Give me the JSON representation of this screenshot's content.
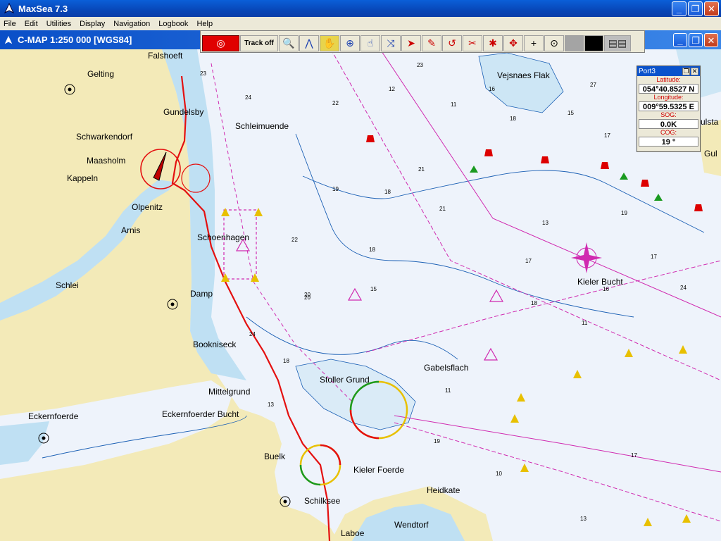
{
  "app": {
    "title": "MaxSea 7.3"
  },
  "menu": [
    "File",
    "Edit",
    "Utilities",
    "Display",
    "Navigation",
    "Logbook",
    "Help"
  ],
  "chart_window": {
    "title": "C-MAP  1:250 000 [WGS84]"
  },
  "toolbar": {
    "track_label": "Track off"
  },
  "port_window": {
    "title": "Port3",
    "latitude_label": "Latitude:",
    "latitude": "054°40.8527 N",
    "longitude_label": "Longitude:",
    "longitude": "009°59.5325 E",
    "sog_label": "SOG:",
    "sog": "0.0K",
    "cog_label": "COG:",
    "cog": "19 °"
  },
  "places": {
    "falshoeft": "Falshoeft",
    "gelting": "Gelting",
    "gundelsby": "Gundelsby",
    "schwarkendorf": "Schwarkendorf",
    "maasholm": "Maasholm",
    "kappeln": "Kappeln",
    "olpenitz": "Olpenitz",
    "arnis": "Arnis",
    "schleimuende": "Schleimuende",
    "schoenhagen": "Schoenhagen",
    "schlei": "Schlei",
    "damp": "Damp",
    "bookniseck": "Bookniseck",
    "mittelgrund": "Mittelgrund",
    "eckernfoerde": "Eckernfoerde",
    "eckernfoerder_bucht": "Eckernfoerder Bucht",
    "stoller_grund": "Stoller Grund",
    "gabelsflach": "Gabelsflach",
    "buelk": "Buelk",
    "kieler_foerde": "Kieler Foerde",
    "heidkate": "Heidkate",
    "schilksee": "Schilksee",
    "wendtorf": "Wendtorf",
    "laboe": "Laboe",
    "kieler_bucht": "Kieler Bucht",
    "vejsnaes_flak": "Vejsnaes Flak",
    "gul": "Gul",
    "ulsta": "ulsta"
  },
  "depths": [
    {
      "v": "23"
    },
    {
      "v": "24"
    },
    {
      "v": "23"
    },
    {
      "v": "12"
    },
    {
      "v": "27"
    },
    {
      "v": "16"
    },
    {
      "v": "11"
    },
    {
      "v": "18"
    },
    {
      "v": "15"
    },
    {
      "v": "22"
    },
    {
      "v": "17"
    },
    {
      "v": "21"
    },
    {
      "v": "19"
    },
    {
      "v": "18"
    },
    {
      "v": "21"
    },
    {
      "v": "22"
    },
    {
      "v": "19"
    },
    {
      "v": "18"
    },
    {
      "v": "15"
    },
    {
      "v": "20"
    },
    {
      "v": "13"
    },
    {
      "v": "17"
    },
    {
      "v": "16"
    },
    {
      "v": "11"
    },
    {
      "v": "18"
    },
    {
      "v": "13"
    },
    {
      "v": "24"
    },
    {
      "v": "24"
    },
    {
      "v": "17"
    },
    {
      "v": "17"
    },
    {
      "v": "11"
    },
    {
      "v": "19"
    },
    {
      "v": "10"
    },
    {
      "v": "13"
    },
    {
      "v": "18"
    },
    {
      "v": "20"
    }
  ]
}
